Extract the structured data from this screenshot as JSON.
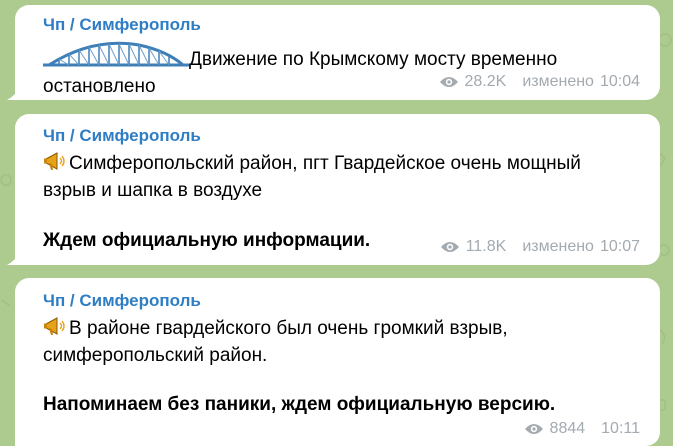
{
  "messages": [
    {
      "sender": "Чп / Симферополь",
      "line1": "Движение по Крымскому мосту временно",
      "line2": "остановлено",
      "views": "28.2K",
      "edited_label": "изменено",
      "time": "10:04",
      "sticker_icon": "bridge-icon"
    },
    {
      "sender": "Чп / Симферополь",
      "line1": "Симферопольский район, пгт Гвардейское очень мощный",
      "line2": "взрыв и шапка в воздухе",
      "line3": "Ждем официальную информации.",
      "views": "11.8K",
      "edited_label": "изменено",
      "time": "10:07",
      "emoji_icon": "megaphone-icon"
    },
    {
      "sender": "Чп / Симферополь",
      "line1": "В районе гвардейского был очень громкий взрыв,",
      "line2": "симферопольский район.",
      "line3": "Напоминаем без паники, ждем официальную версию.",
      "views": "8844",
      "time": "10:11",
      "emoji_icon": "megaphone-icon"
    }
  ],
  "colors": {
    "background": "#aecb8f",
    "sender": "#2f7ec4",
    "meta": "#a3aab0",
    "bubble": "#ffffff"
  }
}
